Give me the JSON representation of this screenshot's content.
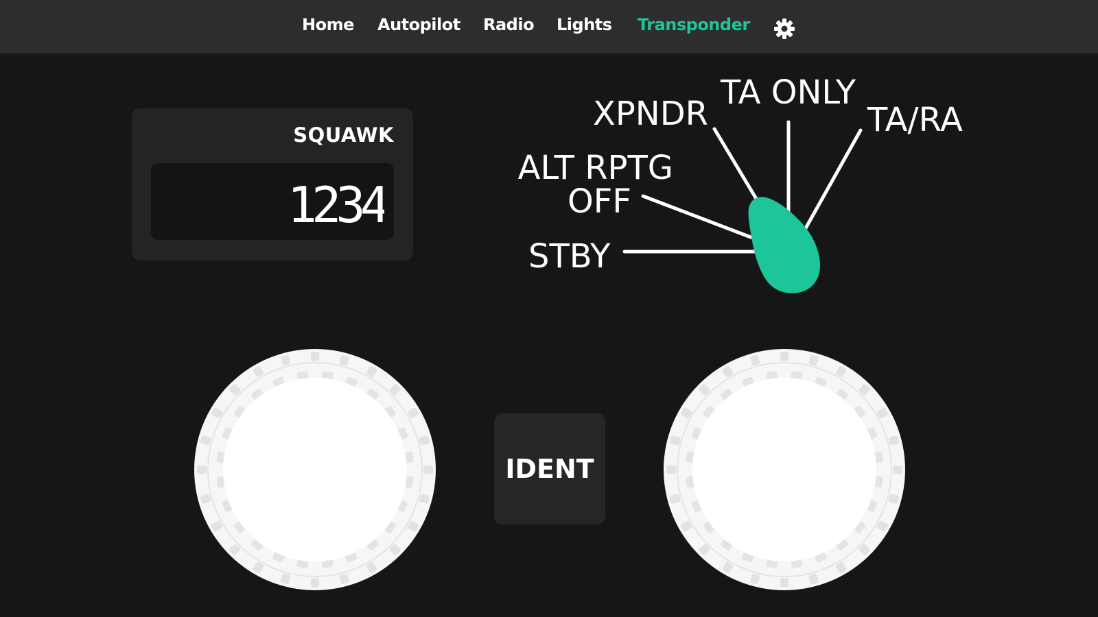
{
  "nav": {
    "items": [
      {
        "label": "Home",
        "active": false
      },
      {
        "label": "Autopilot",
        "active": false
      },
      {
        "label": "Radio",
        "active": false
      },
      {
        "label": "Lights",
        "active": false
      },
      {
        "label": "Transponder",
        "active": true
      }
    ],
    "settings_icon": "gear-icon"
  },
  "squawk": {
    "label": "SQUAWK",
    "code": "1234"
  },
  "mode_selector": {
    "positions": [
      "STBY",
      "ALT RPTG OFF",
      "XPNDR",
      "TA ONLY",
      "TA/RA"
    ],
    "labels": {
      "stby": "STBY",
      "alt_rptg_line1": "ALT RPTG",
      "alt_rptg_line2": "OFF",
      "xpndr": "XPNDR",
      "ta_only": "TA ONLY",
      "ta_ra": "TA/RA"
    },
    "selected": "STBY"
  },
  "ident": {
    "label": "IDENT"
  },
  "colors": {
    "accent": "#1ec49a",
    "background": "#161616",
    "navbar": "#2d2d2d",
    "panel": "#242424"
  }
}
